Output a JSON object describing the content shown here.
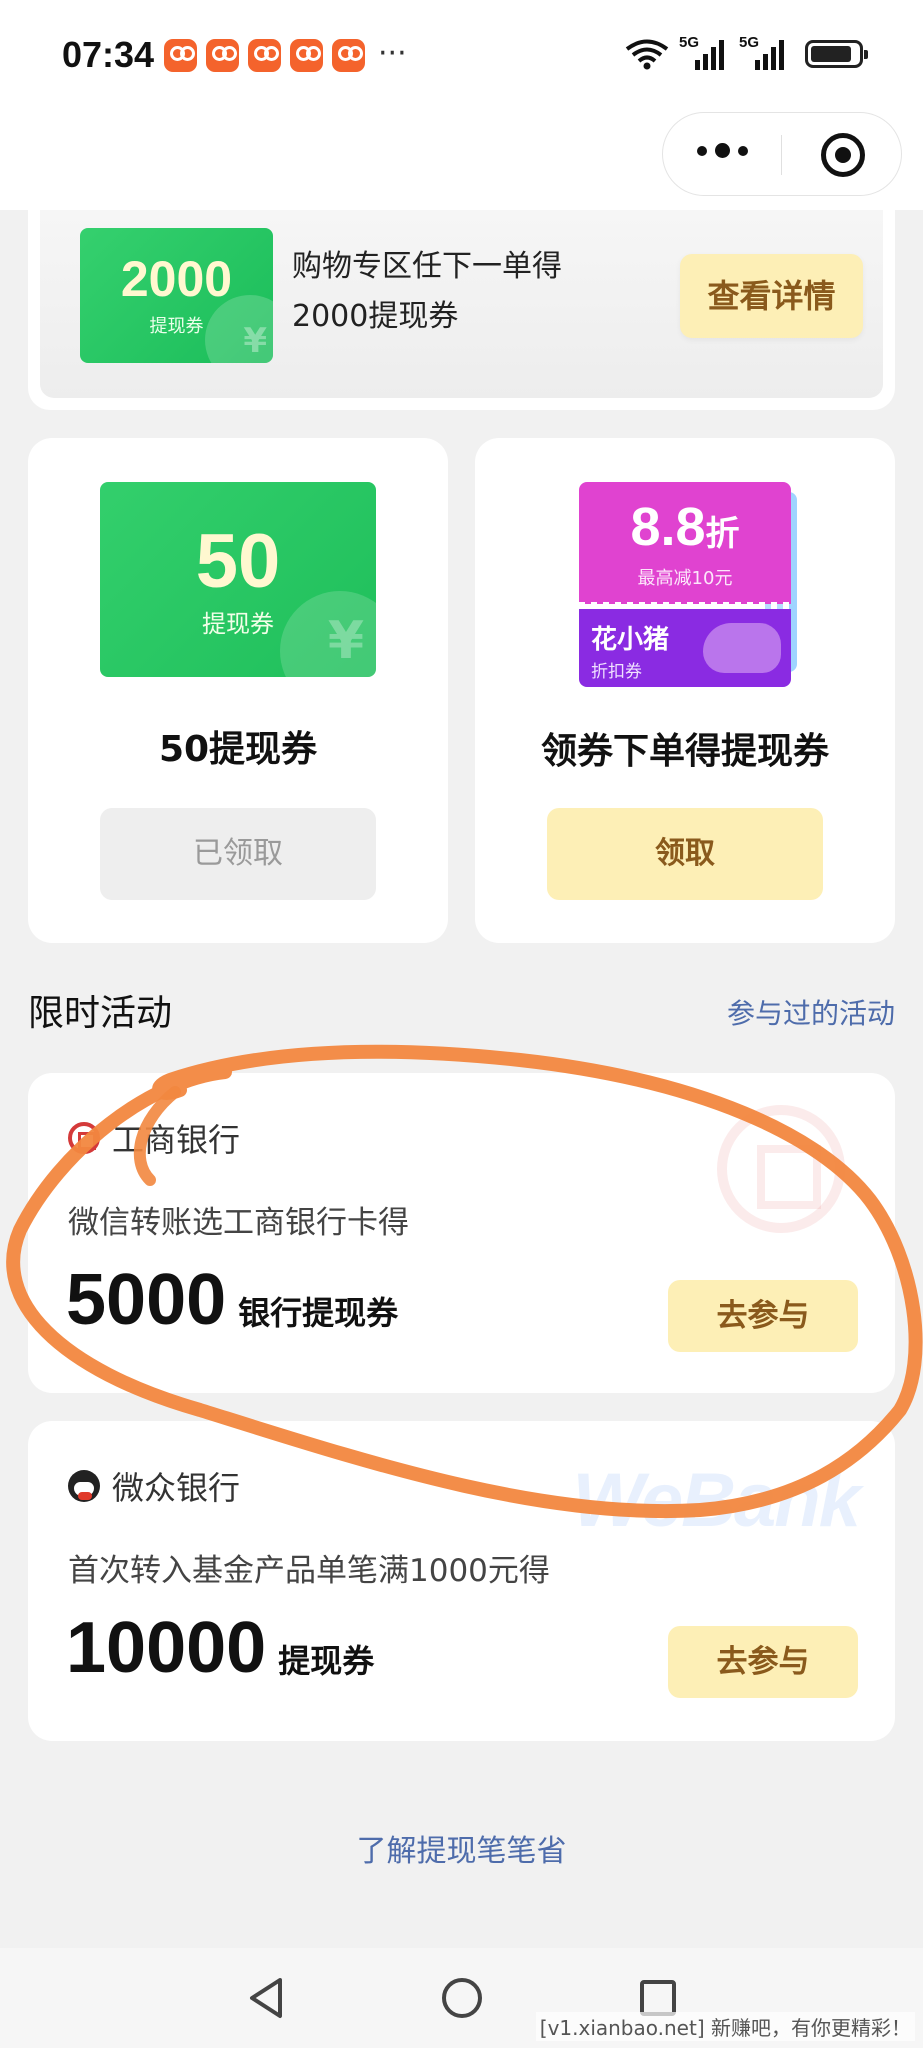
{
  "status_bar": {
    "time": "07:34",
    "more": "···",
    "signal1": "5G",
    "signal2": "5G"
  },
  "top_card": {
    "voucher_amount": "2000",
    "voucher_label": "提现券",
    "yen": "¥",
    "desc_line1": "购物专区任下一单得",
    "desc_line2": "2000提现券",
    "button": "查看详情"
  },
  "left_card": {
    "voucher_amount": "50",
    "voucher_label": "提现券",
    "yen": "¥",
    "title": "50提现券",
    "button": "已领取"
  },
  "right_card": {
    "discount": "8.8",
    "discount_unit": "折",
    "discount_sub": "最高减10元",
    "brand": "花小猪",
    "coupon_kind": "折扣券",
    "title": "领券下单得提现券",
    "button": "领取"
  },
  "section": {
    "title": "限时活动",
    "link": "参与过的活动"
  },
  "activities": [
    {
      "bank": "工商银行",
      "desc": "微信转账选工商银行卡得",
      "amount": "5000",
      "unit": "银行提现券",
      "button": "去参与"
    },
    {
      "bank": "微众银行",
      "desc": "首次转入基金产品单笔满1000元得",
      "amount": "10000",
      "unit": "提现券",
      "button": "去参与",
      "watermark": "WeBank"
    }
  ],
  "footer_link": "了解提现笔笔省",
  "bottom_watermark": "[v1.xianbao.net] 新赚吧，有你更精彩！",
  "colors": {
    "accent_gold_bg": "#fdefb6",
    "accent_gold_text": "#8a5a1c",
    "link_blue": "#4e6cab",
    "voucher_green": "#1fbf5b",
    "annotation_orange": "#f2873f"
  }
}
